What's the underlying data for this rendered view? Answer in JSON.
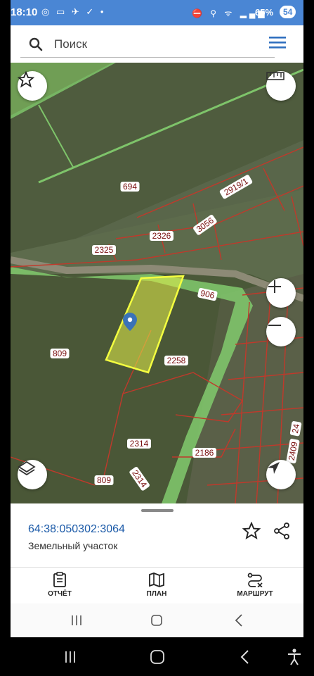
{
  "status_bar": {
    "time": "18:10",
    "left_icons": "◎ ▭ ✈ ✓ •",
    "right_icons": "⛔ ⚲ ᯤ ▂▄▆",
    "percent": "65%",
    "battery": "54"
  },
  "search": {
    "placeholder": "Поиск",
    "value": ""
  },
  "map": {
    "parcel_labels": [
      {
        "text": "694"
      },
      {
        "text": "2919/1"
      },
      {
        "text": "2326"
      },
      {
        "text": "3056"
      },
      {
        "text": "2325"
      },
      {
        "text": "906"
      },
      {
        "text": "809"
      },
      {
        "text": "2258"
      },
      {
        "text": "2314"
      },
      {
        "text": "2186"
      },
      {
        "text": "809"
      },
      {
        "text": "2314"
      },
      {
        "text": "2409"
      },
      {
        "text": "24"
      }
    ],
    "colors": {
      "boundary_green": "#7ec46a",
      "boundary_red": "#c0392b",
      "selected_fill": "#e6f04a"
    }
  },
  "parcel": {
    "cadastral_number": "64:38:050302:3064",
    "type": "Земельный участок"
  },
  "tabs": [
    {
      "label": "ОТЧЁТ",
      "icon": "clipboard-icon"
    },
    {
      "label": "ПЛАН",
      "icon": "map-icon"
    },
    {
      "label": "МАРШРУТ",
      "icon": "route-icon"
    }
  ],
  "accent_color": "#2f6fbf"
}
